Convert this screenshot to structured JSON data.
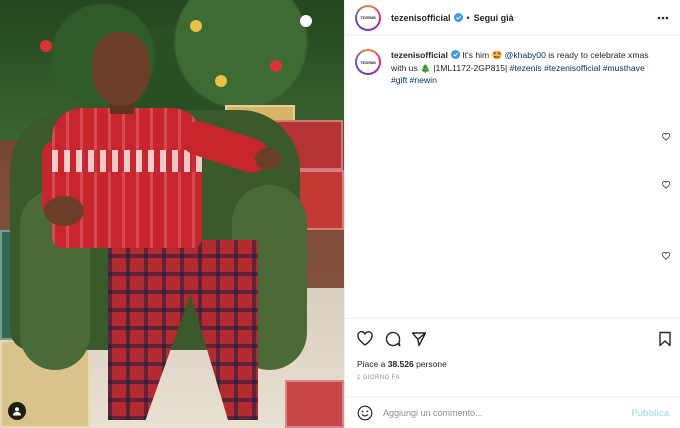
{
  "post": {
    "username": "tezenisofficial",
    "avatar_text": "TEZENIS",
    "follow_label": "Segui già",
    "separator": "•",
    "caption": {
      "username": "tezenisofficial",
      "text_1": " It's him 🤩 ",
      "mention": "@khaby00",
      "text_2": " is ready to celebrate xmas with us 🎄 |1ML1172-2GP815| ",
      "hashtags": [
        "#tezenis",
        "#tezenisofficial",
        "#musthave",
        "#gift",
        "#newin"
      ]
    },
    "likes_prefix": "Piace a ",
    "likes_count": "38.526",
    "likes_suffix": " persone",
    "time": "1 GIORNO FA",
    "comment_placeholder": "Aggiungi un commento...",
    "post_button": "Pubblica"
  },
  "colors": {
    "verified": "#3897f0",
    "link": "#00376b",
    "publish_disabled": "#b2dffc"
  },
  "icons": [
    "verified-icon",
    "more-icon",
    "heart-icon",
    "comment-icon",
    "share-icon",
    "bookmark-icon",
    "emoji-icon",
    "user-tag-icon"
  ]
}
